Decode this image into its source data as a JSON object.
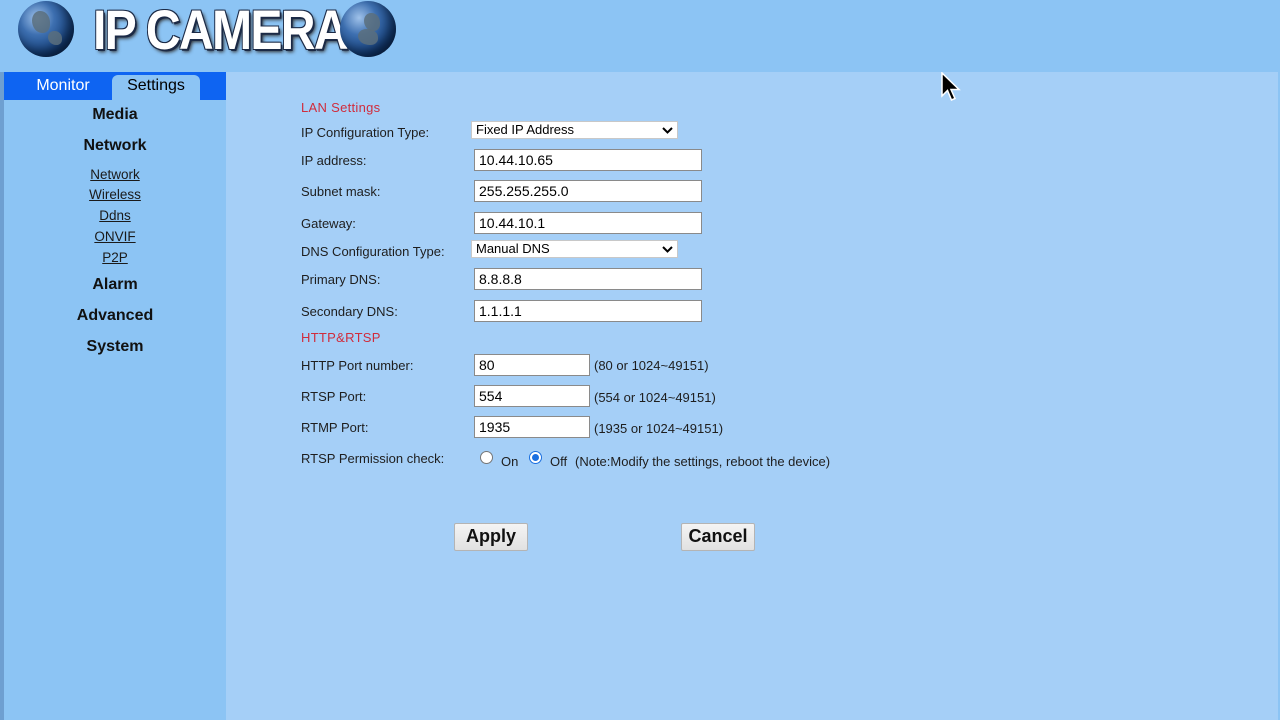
{
  "header": {
    "logo_text": "IP CAMERA"
  },
  "tabs": {
    "monitor": "Monitor",
    "settings": "Settings"
  },
  "sidebar": {
    "media": "Media",
    "network": "Network",
    "sub": [
      "Network",
      "Wireless",
      "Ddns",
      "ONVIF",
      "P2P"
    ],
    "alarm": "Alarm",
    "advanced": "Advanced",
    "system": "System"
  },
  "lan": {
    "title": "LAN Settings",
    "ip_config_label": "IP Configuration Type:",
    "ip_config_value": "Fixed IP Address",
    "ip_label": "IP address:",
    "ip_value": "10.44.10.65",
    "subnet_label": "Subnet mask:",
    "subnet_value": "255.255.255.0",
    "gateway_label": "Gateway:",
    "gateway_value": "10.44.10.1",
    "dns_config_label": "DNS Configuration Type:",
    "dns_config_value": "Manual DNS",
    "dns1_label": "Primary DNS:",
    "dns1_value": "8.8.8.8",
    "dns2_label": "Secondary DNS:",
    "dns2_value": "1.1.1.1"
  },
  "http": {
    "title": "HTTP&RTSP",
    "http_label": "HTTP Port number:",
    "http_value": "80",
    "http_hint": "(80 or 1024~49151)",
    "rtsp_label": "RTSP Port:",
    "rtsp_value": "554",
    "rtsp_hint": "(554 or 1024~49151)",
    "rtmp_label": "RTMP Port:",
    "rtmp_value": "1935",
    "rtmp_hint": "(1935 or 1024~49151)",
    "perm_label": "RTSP Permission check:",
    "on_label": "On",
    "off_label": "Off",
    "selected": "Off",
    "note": "(Note:Modify the settings, reboot the device)"
  },
  "buttons": {
    "apply": "Apply",
    "cancel": "Cancel"
  },
  "colors": {
    "header_bg": "#8cc4f4",
    "content_bg": "#a5cff7",
    "tab_bar": "#0e64f2",
    "section_title": "#d02c3c"
  }
}
